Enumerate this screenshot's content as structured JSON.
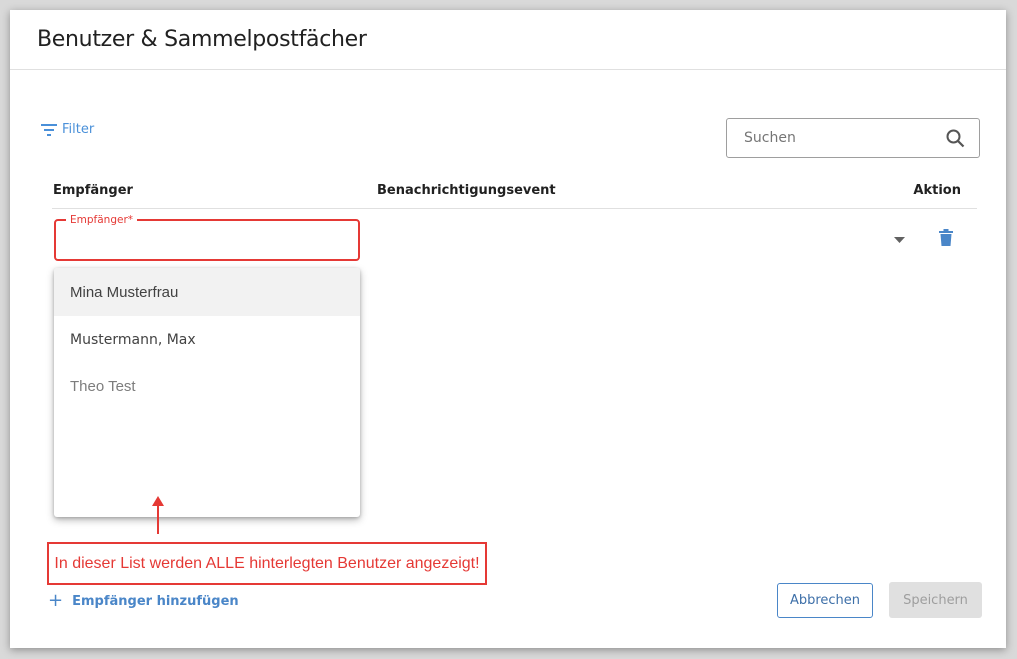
{
  "dialog": {
    "title": "Benutzer & Sammelpostfächer"
  },
  "toolbar": {
    "filter_label": "Filter",
    "search_placeholder": "Suchen"
  },
  "table": {
    "columns": [
      "Empfänger",
      "Benachrichtigungsevent",
      "Aktion"
    ]
  },
  "row": {
    "recipient_field_label": "Empfänger*",
    "recipient_value": "",
    "recipient_options": [
      "Mina Musterfrau",
      "Mustermann, Max",
      "Theo Test"
    ],
    "highlighted_option": "Mina Musterfrau"
  },
  "annotation": {
    "text": "In dieser List werden ALLE hinterlegten Benutzer angezeigt!"
  },
  "footer": {
    "add_recipient_label": "Empfänger hinzufügen",
    "cancel_label": "Abbrechen",
    "save_label": "Speichern"
  },
  "colors": {
    "accent": "#4a86c8",
    "error": "#e53935",
    "disabled": "#e0e0e0"
  },
  "icons": [
    "filter-icon",
    "search-icon",
    "chevron-down-icon",
    "trash-icon",
    "plus-icon",
    "arrow-up-icon"
  ]
}
